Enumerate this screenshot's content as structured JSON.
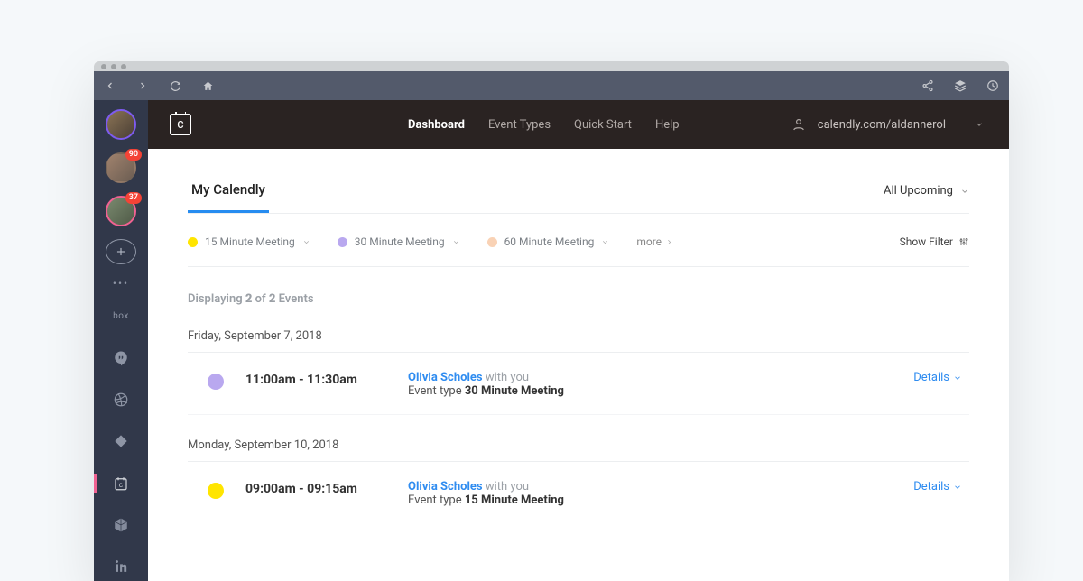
{
  "sidebar": {
    "badges": [
      "90",
      "37"
    ],
    "apps": [
      "box",
      "hangouts",
      "dribbble",
      "diamond",
      "calendar",
      "cube",
      "linkedin"
    ]
  },
  "header": {
    "nav": {
      "dashboard": "Dashboard",
      "event_types": "Event Types",
      "quick_start": "Quick Start",
      "help": "Help"
    },
    "user_url": "calendly.com/aldannerol"
  },
  "tabs": {
    "main": "My Calendly",
    "dropdown": "All Upcoming"
  },
  "meeting_types": {
    "t15": "15 Minute Meeting",
    "t30": "30 Minute Meeting",
    "t60": "60 Minute Meeting",
    "more": "more",
    "show_filter": "Show Filter"
  },
  "summary": {
    "prefix": "Displaying ",
    "a": "2",
    "mid": " of ",
    "b": "2",
    "suffix": " Events"
  },
  "days": [
    {
      "label": "Friday, September 7, 2018",
      "events": [
        {
          "color": "purple",
          "time": "11:00am - 11:30am",
          "name": "Olivia Scholes",
          "with": "with you",
          "type_prefix": "Event type ",
          "type": "30 Minute Meeting",
          "details": "Details"
        }
      ]
    },
    {
      "label": "Monday, September 10, 2018",
      "events": [
        {
          "color": "yellow",
          "time": "09:00am - 09:15am",
          "name": "Olivia Scholes",
          "with": "with you",
          "type_prefix": "Event type ",
          "type": "15 Minute Meeting",
          "details": "Details"
        }
      ]
    }
  ]
}
